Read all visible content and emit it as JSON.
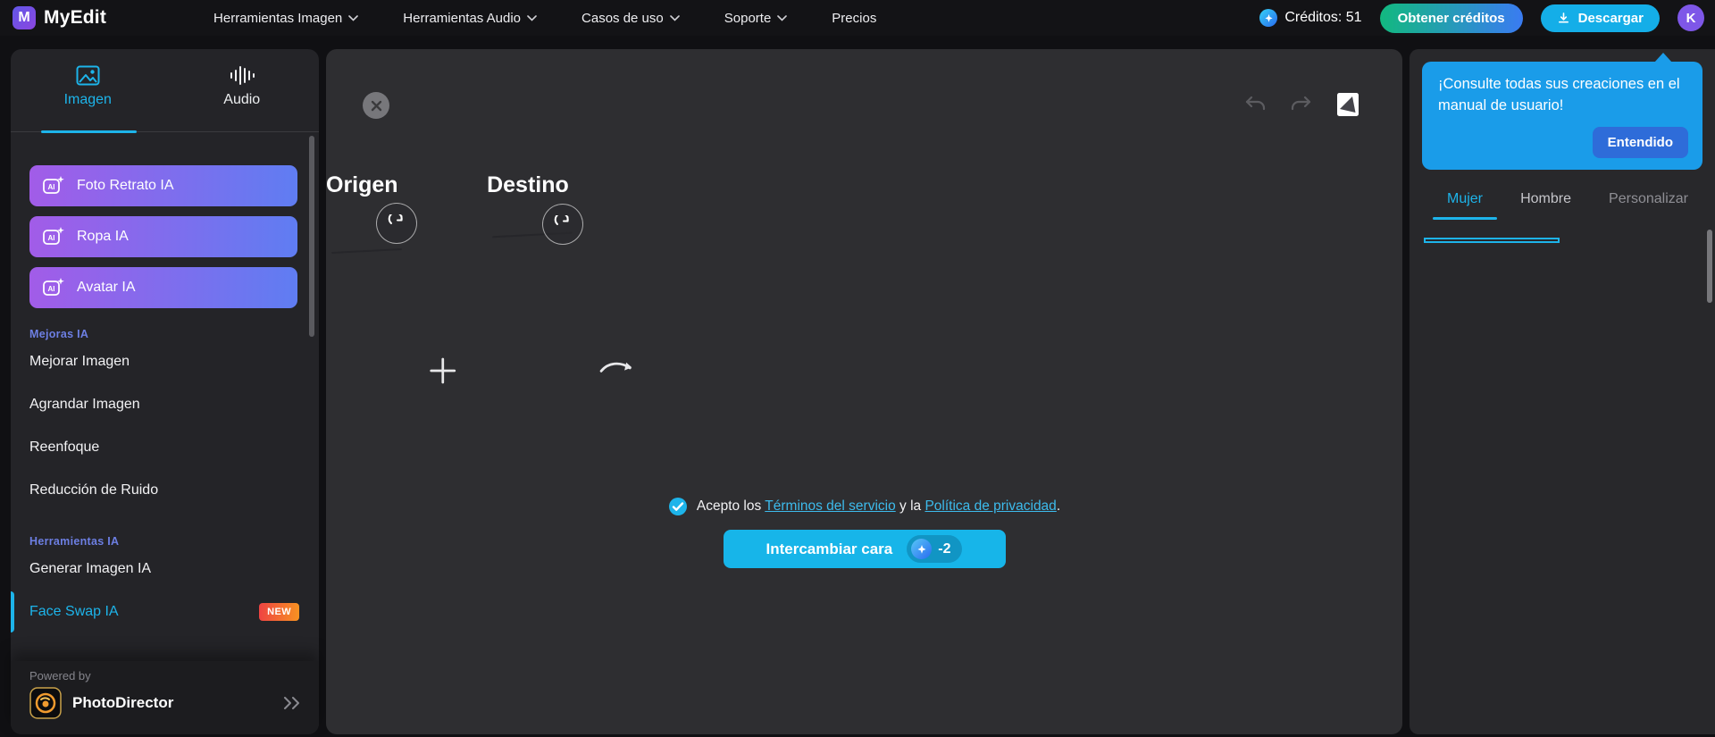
{
  "theme": {
    "style": "--accent:#1db4ea;--tooltip:#1a9ce9;--entendido:#2e6cd9;--action-cyan:#17b5e9;--download-blue:#14aee8;--grad-purple:linear-gradient(92deg,#a25ce8,#5f7df2);--grad-credits:linear-gradient(92deg,#12b97f,#3a7bf2);--badge:linear-gradient(92deg,#ef4343,#f79321)",
    "accent_cyan": "#1db4ea",
    "tooltip_blue": "#1a9ce9",
    "button_gradient_purple": [
      "#a25ce8",
      "#5f7df2"
    ],
    "credits_gradient": [
      "#12b97f",
      "#3a7bf2"
    ]
  },
  "topbar": {
    "brand": "MyEdit",
    "nav": [
      {
        "label": "Herramientas Imagen"
      },
      {
        "label": "Herramientas Audio"
      },
      {
        "label": "Casos de uso"
      },
      {
        "label": "Soporte"
      },
      {
        "label": "Precios"
      }
    ],
    "credits": "Créditos: 51",
    "get_credits": "Obtener créditos",
    "download": "Descargar",
    "avatar": "K"
  },
  "sidebar": {
    "tabs": [
      {
        "label": "Imagen"
      },
      {
        "label": "Audio"
      }
    ],
    "tools": [
      {
        "label": "Foto Retrato IA"
      },
      {
        "label": "Ropa IA"
      },
      {
        "label": "Avatar IA"
      }
    ],
    "sections": [
      {
        "title": "Mejoras IA",
        "items": [
          {
            "label": "Mejorar Imagen"
          },
          {
            "label": "Agrandar Imagen"
          },
          {
            "label": "Reenfoque"
          },
          {
            "label": "Reducción de Ruido"
          }
        ]
      },
      {
        "title": "Herramientas IA",
        "items": [
          {
            "label": "Generar Imagen IA"
          },
          {
            "label": "Face Swap IA",
            "badge": "NEW"
          }
        ]
      }
    ],
    "powered_by": "Powered by",
    "powered_app": "PhotoDirector"
  },
  "canvas": {
    "source_label": "Origen",
    "target_label": "Destino",
    "source_image": {
      "name": "foto-mujer-rubia",
      "style": "--bg:linear-gradient(160deg,#ddd7d1,#cdc6bf);--hair:#cfa265;--skin:#eabd9f;--top:#f2f1f3"
    },
    "target_image": {
      "name": "mujer-con-gatitos-rosas",
      "style": "--bg:linear-gradient(160deg,#c8879f,#a96584);--hair:#7a5c3e;--skin:#e9b9a2;--top:#d490ae;--pet:#efb6c0"
    },
    "result_image": {
      "name": "resultado-face-swap",
      "style": "--bg:linear-gradient(160deg,#c07e96,#a86583);--hair:#c9a268;--skin:#ecc0a4;--top:#d490ae;--pet:#f0c0b2"
    },
    "terms": {
      "prefix": "Acepto los",
      "link1": "Términos del servicio",
      "middle": "y la",
      "link2": "Política de privacidad",
      "suffix": "."
    },
    "action": {
      "label": "Intercambiar cara",
      "cost": "-2"
    }
  },
  "right_panel": {
    "tooltip": {
      "text": "¡Consulte todas sus creaciones en el manual de usuario!",
      "button": "Entendido"
    },
    "tabs": [
      {
        "label": "Mujer"
      },
      {
        "label": "Hombre"
      },
      {
        "label": "Personalizar"
      }
    ],
    "thumbnails": [
      {
        "name": "mujer-gatitos-rosas",
        "selected": true,
        "style": "--bg:linear-gradient(160deg,#c8879f,#a96584);--hair:#7a5c3e;--skin:#e9b9a2;--top:#d490ae;--pet:#efb6c0"
      },
      {
        "name": "mujer-patatas-fritas-gato-negro",
        "style": "--bg:linear-gradient(160deg,#d9b557,#a8822f);--hair:#26262b;--skin:#ecc5a8;--top:#e8e3da;--pet:#1d1d22"
      },
      {
        "name": "mujer-flores-conejo",
        "style": "--bg:linear-gradient(160deg,#8fb3d1,#6f95b6);--hair:#4d3a2e;--skin:#e7bb9f;--top:#bcd3e2;--pet:#f2f2f0"
      },
      {
        "name": "mujer-unicornio-flores",
        "style": "--bg:linear-gradient(160deg,#e3b3b0,#caa3a0);--hair:#d9c091;--skin:#edc6ab;--top:#cbd8b4;--pet:#ece9e6"
      },
      {
        "name": "mujer-invierno-gorro",
        "style": "--bg:linear-gradient(160deg,#dfe7ec,#9db3be);--hair:#f0e9dc;--skin:#ecc3a6;--top:#efe8dd;--pet:#f5f1ea"
      },
      {
        "name": "chica-gotica-cuervo",
        "style": "--bg:linear-gradient(160deg,#a2a2a6,#7e7e84);--hair:#17171c;--skin:#eccdb9;--top:#26262e;--pet:#101014"
      }
    ]
  }
}
